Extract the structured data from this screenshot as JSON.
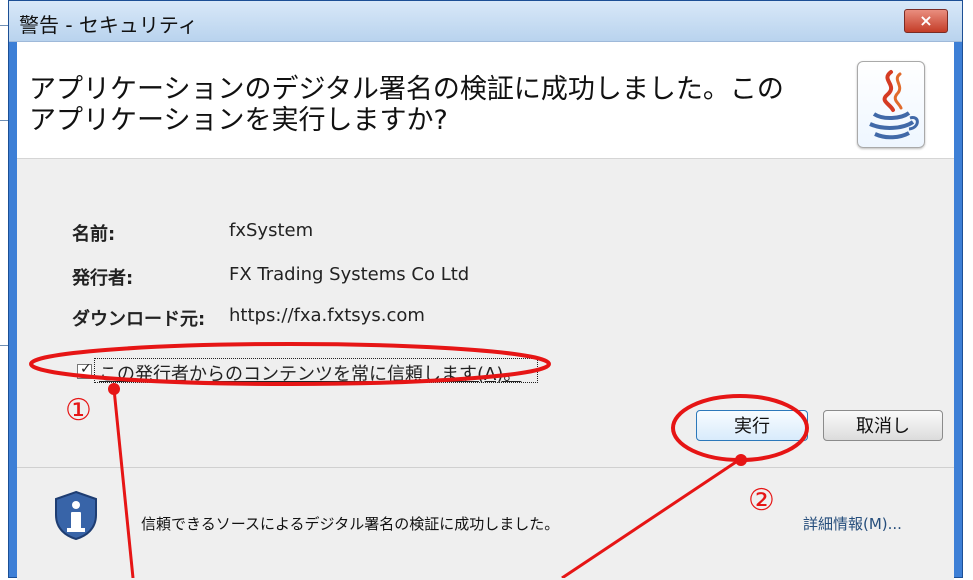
{
  "window": {
    "title": "警告 - セキュリティ",
    "close_icon": "close-icon"
  },
  "header": {
    "message": "アプリケーションのデジタル署名の検証に成功しました。このアプリケーションを実行しますか?",
    "logo_icon": "java-cup-icon"
  },
  "details": {
    "name_label": "名前:",
    "name_value": "fxSystem",
    "publisher_label": "発行者:",
    "publisher_value": "FX Trading Systems Co Ltd",
    "download_label": "ダウンロード元:",
    "download_value": "https://fxa.fxtsys.com"
  },
  "checkbox": {
    "label": "この発行者からのコンテンツを常に信頼します(A)。",
    "checked": true
  },
  "buttons": {
    "run": "実行",
    "cancel": "取消し"
  },
  "footer": {
    "status_text": "信頼できるソースによるデジタル署名の検証に成功しました。",
    "details_link": "詳細情報(M)..."
  },
  "annotations": {
    "marker_1": "①",
    "marker_2": "②"
  },
  "colors": {
    "window_blue": "#3d7fd6",
    "annotation_red": "#e61515"
  }
}
